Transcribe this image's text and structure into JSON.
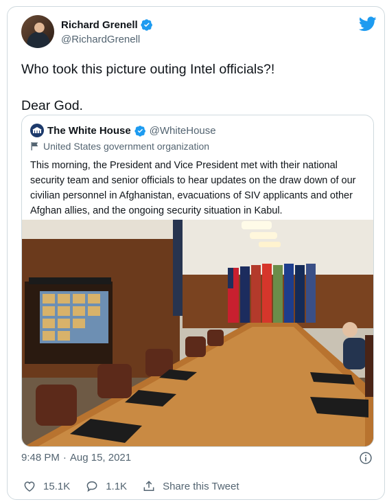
{
  "tweet": {
    "author": {
      "display_name": "Richard Grenell",
      "handle": "@RichardGrenell",
      "verified": true,
      "avatar_icon": "user-avatar"
    },
    "platform_icon": "twitter-bird-icon",
    "text_lines": [
      "Who took this picture outing Intel officials?!",
      "Dear God."
    ],
    "timestamp": "9:48 PM · Aug 15, 2021",
    "time": "9:48 PM",
    "separator": "·",
    "date": "Aug 15, 2021",
    "actions": {
      "likes": "15.1K",
      "replies": "1.1K",
      "share_label": "Share this Tweet"
    }
  },
  "quoted_tweet": {
    "display_name": "The White House",
    "handle": "@WhiteHouse",
    "verified": true,
    "label": "United States government organization",
    "text": "This morning, the President and Vice President met with their national security team and senior officials to hear updates on the draw down of our civilian personnel in Afghanistan, evacuations of SIV applicants and other Afghan allies, and the ongoing security situation in Kabul.",
    "media": {
      "type": "photo",
      "description_icon": "conference-room-photo"
    }
  },
  "colors": {
    "accent": "#1d9bf0",
    "text": "#0f1419",
    "muted": "#536471",
    "border": "#cfd9de"
  }
}
